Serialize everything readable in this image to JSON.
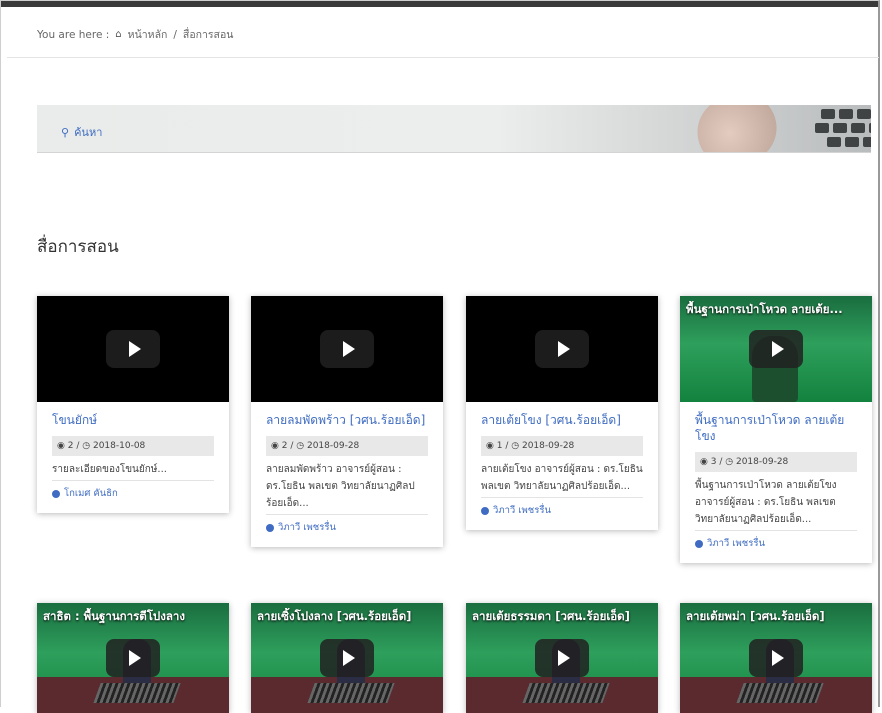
{
  "breadcrumb": {
    "prefix": "You are here :",
    "home": "หน้าหลัก",
    "separator": "/",
    "current": "สื่อการสอน"
  },
  "banner": {
    "search_label": "ค้นหา"
  },
  "section_title": "สื่อการสอน",
  "cards": [
    {
      "title": "โขนยักษ์",
      "views": "2",
      "date": "2018-10-08",
      "desc": "รายละเอียดของโขนยักษ์...",
      "author": "โกเมศ คันธิก"
    },
    {
      "title": "ลายลมพัดพร้าว [วศน.ร้อยเอ็ด]",
      "views": "2",
      "date": "2018-09-28",
      "desc": "ลายลมพัดพร้าว อาจารย์ผู้สอน : ดร.โยธิน พลเขต วิทยาลัยนาฏศิลปร้อยเอ็ด...",
      "author": "วิภาวี เพชรรื่น"
    },
    {
      "title": "ลายเต้ยโขง [วศน.ร้อยเอ็ด]",
      "views": "1",
      "date": "2018-09-28",
      "desc": "ลายเต้ยโขง อาจารย์ผู้สอน : ดร.โยธิน พลเขต วิทยาลัยนาฏศิลปร้อยเอ็ด...",
      "author": "วิภาวี เพชรรื่น"
    },
    {
      "video_title": "พื้นฐานการเป่าโหวด ลายเต้ย...",
      "title": "พื้นฐานการเป่าโหวด ลายเต้ยโขง",
      "views": "3",
      "date": "2018-09-28",
      "desc": "พื้นฐานการเป่าโหวด ลายเต้ยโขง อาจารย์ผู้สอน : ดร.โยธิน พลเขต วิทยาลัยนาฏศิลปร้อยเอ็ด...",
      "author": "วิภาวี เพชรรื่น"
    }
  ],
  "row2_videos": [
    {
      "video_title": "สาธิต : พื้นฐานการตีโปงลาง"
    },
    {
      "video_title": "ลายเซิ้งโปงลาง [วศน.ร้อยเอ็ด]"
    },
    {
      "video_title": "ลายเต้ยธรรมดา [วศน.ร้อยเอ็ด]"
    },
    {
      "video_title": "ลายเต้ยพม่า [วศน.ร้อยเอ็ด]"
    }
  ],
  "icons": {
    "home": "home-icon",
    "search": "search-icon",
    "views": "eye-icon",
    "date": "clock-icon",
    "author": "user-icon",
    "play": "play-icon"
  },
  "colors": {
    "link": "#3f6cc2",
    "meta_bg": "#e8e8e8"
  }
}
